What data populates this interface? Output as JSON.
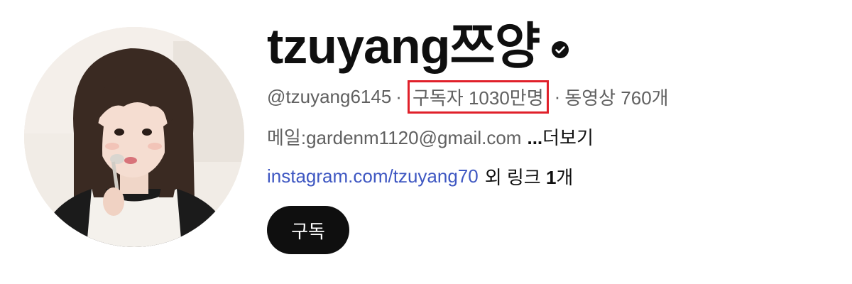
{
  "channel": {
    "title": "tzuyang쯔양",
    "verified_icon": "verified-check-icon",
    "handle": "@tzuyang6145",
    "separator": "·",
    "subscribers": "구독자 1030만명",
    "videos": "동영상 760개",
    "description": "메일:gardenm1120@gmail.com",
    "more_dots": "...",
    "more_label": "더보기",
    "link_text": "instagram.com/tzuyang70",
    "other_links_prefix": "외 링크",
    "other_links_count": "1",
    "other_links_suffix": "개",
    "subscribe_label": "구독"
  },
  "colors": {
    "highlight_border": "#e0202a",
    "link": "#3e57c2",
    "subscribe_bg": "#0f0f0f",
    "secondary_text": "#606060"
  }
}
